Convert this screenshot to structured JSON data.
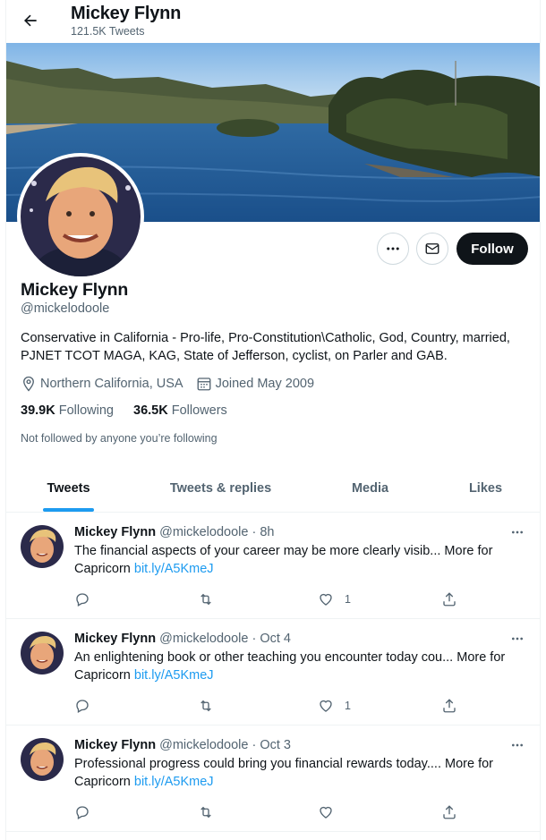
{
  "header": {
    "name": "Mickey Flynn",
    "tweet_count": "121.5K Tweets"
  },
  "profile": {
    "name": "Mickey Flynn",
    "handle": "@mickelodoole",
    "bio": "Conservative in California - Pro-life, Pro-Constitution\\Catholic, God, Country, married, PJNET TCOT MAGA, KAG, State of Jefferson, cyclist, on Parler and GAB.",
    "location": "Northern California, USA",
    "joined": "Joined May 2009",
    "following_count": "39.9K",
    "following_label": "Following",
    "followers_count": "36.5K",
    "followers_label": "Followers",
    "not_followed": "Not followed by anyone you’re following"
  },
  "actions": {
    "follow_label": "Follow",
    "more_icon": "more-horizontal-icon",
    "message_icon": "envelope-icon"
  },
  "tabs": [
    {
      "label": "Tweets",
      "active": true
    },
    {
      "label": "Tweets & replies",
      "active": false
    },
    {
      "label": "Media",
      "active": false
    },
    {
      "label": "Likes",
      "active": false
    }
  ],
  "tweets": [
    {
      "name": "Mickey Flynn",
      "handle": "@mickelodoole · 8h",
      "text": "The financial aspects of your career may be more clearly visib... More for Capricorn ",
      "link": "bit.ly/A5KmeJ",
      "likes": "1"
    },
    {
      "name": "Mickey Flynn",
      "handle": "@mickelodoole · Oct 4",
      "text": "An enlightening book or other teaching you encounter today cou... More for Capricorn ",
      "link": "bit.ly/A5KmeJ",
      "likes": "1"
    },
    {
      "name": "Mickey Flynn",
      "handle": "@mickelodoole · Oct 3",
      "text": "Professional progress could bring you financial rewards today.... More for Capricorn ",
      "link": "bit.ly/A5KmeJ",
      "likes": ""
    }
  ],
  "colors": {
    "accent": "#1d9bf0",
    "text": "#0f1419",
    "secondary": "#536471",
    "border": "#eff3f4"
  }
}
